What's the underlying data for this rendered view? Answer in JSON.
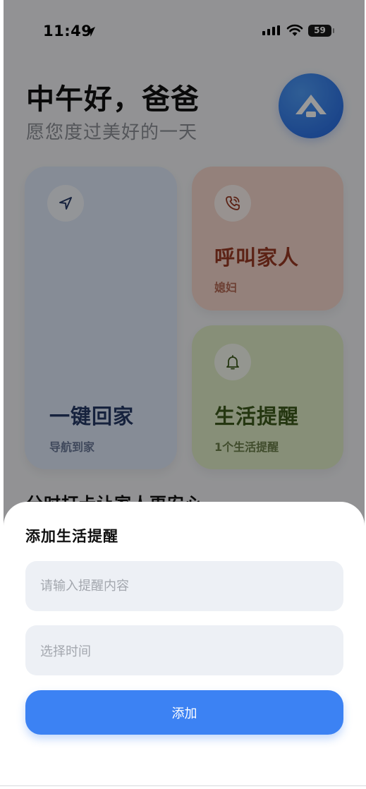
{
  "status_bar": {
    "time": "11:49",
    "battery": "59"
  },
  "header": {
    "greeting": "中午好，爸爸",
    "subtitle": "愿您度过美好的一天",
    "logo_icon": "home-logo-icon"
  },
  "cards": {
    "home": {
      "title": "一键回家",
      "subtitle": "导航到家",
      "icon": "navigation-arrow-icon",
      "color": "#dfe9fb"
    },
    "call": {
      "title": "呼叫家人",
      "subtitle": "媳妇",
      "icon": "phone-icon",
      "color": "#f7d8cd"
    },
    "reminder": {
      "title": "生活提醒",
      "subtitle": "1个生活提醒",
      "icon": "bell-icon",
      "color": "#e1eec9"
    }
  },
  "section_peek": "分时打卡让家人更安心",
  "sheet": {
    "title": "添加生活提醒",
    "content_placeholder": "请输入提醒内容",
    "time_placeholder": "选择时间",
    "add_label": "添加",
    "accent": "#3c82f3"
  }
}
